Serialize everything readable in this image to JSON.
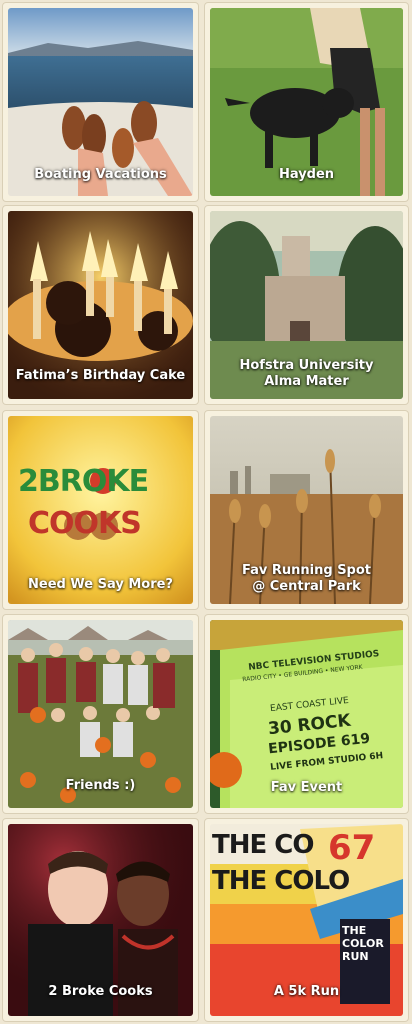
{
  "tiles": [
    {
      "caption": "Boating Vacations"
    },
    {
      "caption": "Hayden"
    },
    {
      "caption": "Fatima’s Birthday Cake"
    },
    {
      "caption": "Hofstra University\nAlma Mater"
    },
    {
      "caption": "Need We Say More?"
    },
    {
      "caption": "Fav Running Spot\n@ Central  Park"
    },
    {
      "caption": "Friends :)"
    },
    {
      "caption": "Fav Event"
    },
    {
      "caption": "2 Broke Cooks"
    },
    {
      "caption": "A 5k Run"
    }
  ],
  "logo": {
    "line1": "2BROKE",
    "line2": "COOKS"
  },
  "ticket": {
    "header": "NBC TELEVISION STUDIOS",
    "sub": "RADIO CITY • GE BUILDING • NEW YORK",
    "live": "EAST COAST LIVE",
    "show": "30 ROCK",
    "episode": "EPISODE 619",
    "from": "LIVE FROM STUDIO 6H"
  },
  "run_poster": {
    "text1": "THE CO",
    "text2": "THE COLO",
    "bib": "67",
    "book": "THE COLOR RUN"
  }
}
